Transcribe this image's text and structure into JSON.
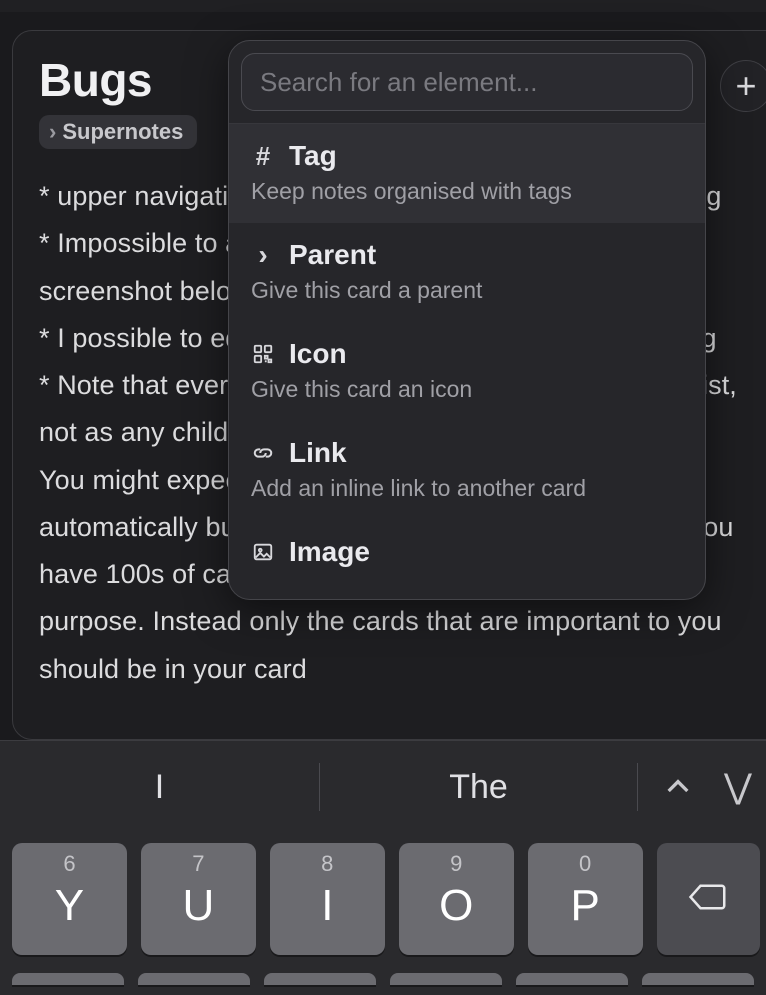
{
  "card": {
    "title": "Bugs",
    "parent_chip": "Supernotes",
    "body": "* upper navigation bar flashes when opening and closing\n* Impossible to add Tags from iOS-iPadOS (see screenshot below)\n* I possible to edit tags when added on iOS: the add Tag\n* Note that every card added will be added to the card list, not as any child cards to it.\nYou might expect all your cards to be indexed automatically but we have avoided doing this as once you have 100s of cards in the sidebar it starts to lose its purpose. Instead only the cards that are important to you should be in your card"
  },
  "add_button": "+",
  "popup": {
    "placeholder": "Search for an element...",
    "items": [
      {
        "glyph": "#",
        "label": "Tag",
        "desc": "Keep notes organised with tags"
      },
      {
        "glyph": "›",
        "label": "Parent",
        "desc": "Give this card a parent"
      },
      {
        "glyph": "qr",
        "label": "Icon",
        "desc": "Give this card an icon"
      },
      {
        "glyph": "link",
        "label": "Link",
        "desc": "Add an inline link to another card"
      },
      {
        "glyph": "img",
        "label": "Image",
        "desc": ""
      }
    ]
  },
  "keyboard": {
    "predictions": [
      "I",
      "The"
    ],
    "keys": [
      {
        "sub": "6",
        "main": "Y"
      },
      {
        "sub": "7",
        "main": "U"
      },
      {
        "sub": "8",
        "main": "I"
      },
      {
        "sub": "9",
        "main": "O"
      },
      {
        "sub": "0",
        "main": "P"
      }
    ]
  }
}
